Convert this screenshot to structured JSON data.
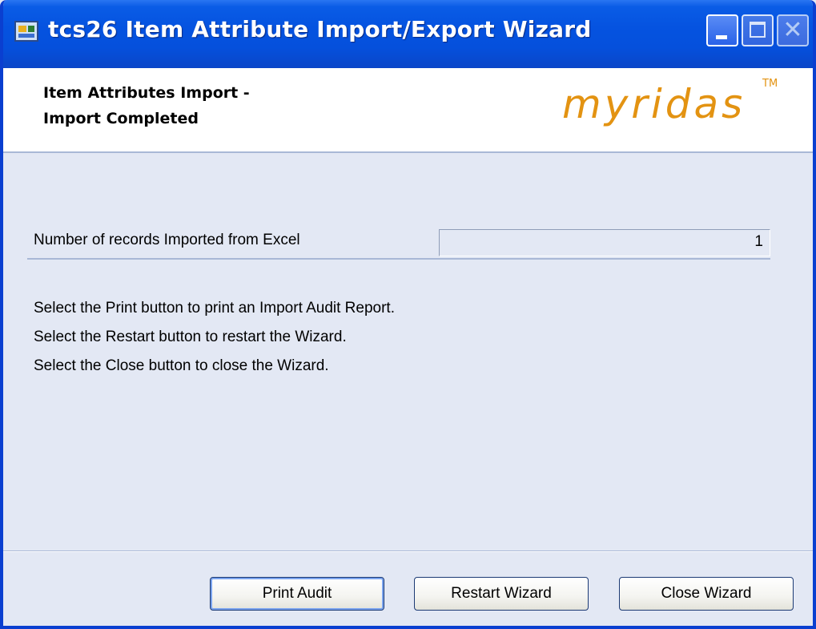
{
  "window": {
    "title": "tcs26 Item Attribute Import/Export Wizard",
    "icons": {
      "app": "app-window-icon",
      "minimize": "minimize-icon",
      "maximize": "maximize-icon",
      "close": "close-icon"
    },
    "colors": {
      "titlebar": "#0553e0",
      "body": "#e3e8f4",
      "logo": "#e39312"
    }
  },
  "header": {
    "line1": "Item Attributes Import -",
    "line2": "Import Completed",
    "logo": "myridas",
    "logo_tm": "TM"
  },
  "form": {
    "records_label": "Number of records Imported from Excel",
    "records_value": "1"
  },
  "instructions": [
    "Select the Print button to print an Import Audit Report.",
    "Select the Restart button to restart the Wizard.",
    "Select the Close button to close the Wizard."
  ],
  "buttons": {
    "print": "Print Audit",
    "restart": "Restart Wizard",
    "close": "Close Wizard"
  },
  "title_buttons": {
    "close_glyph": "✕"
  }
}
